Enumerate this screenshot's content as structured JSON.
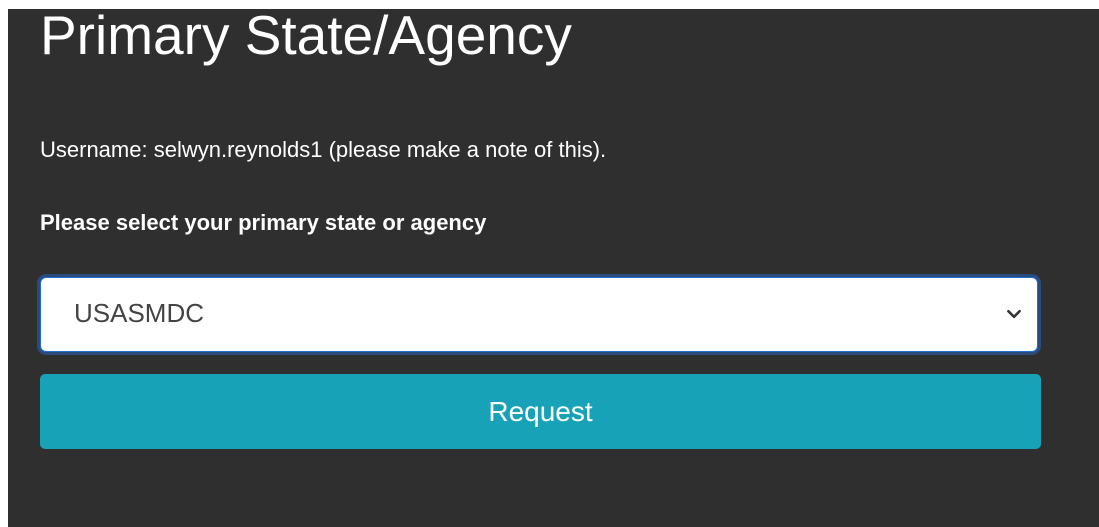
{
  "page": {
    "title": "Primary State/Agency",
    "username_text": "Username: selwyn.reynolds1 (please make a note of this).",
    "prompt_label": "Please select your primary state or agency"
  },
  "form": {
    "agency_select": {
      "selected_value": "USASMDC",
      "icon": "chevron-down-icon"
    },
    "request_button_label": "Request"
  },
  "colors": {
    "panel_background": "#2f2f2f",
    "button_background": "#17a2b8",
    "focus_ring": "#1f6fcf",
    "text_primary": "#ffffff"
  }
}
